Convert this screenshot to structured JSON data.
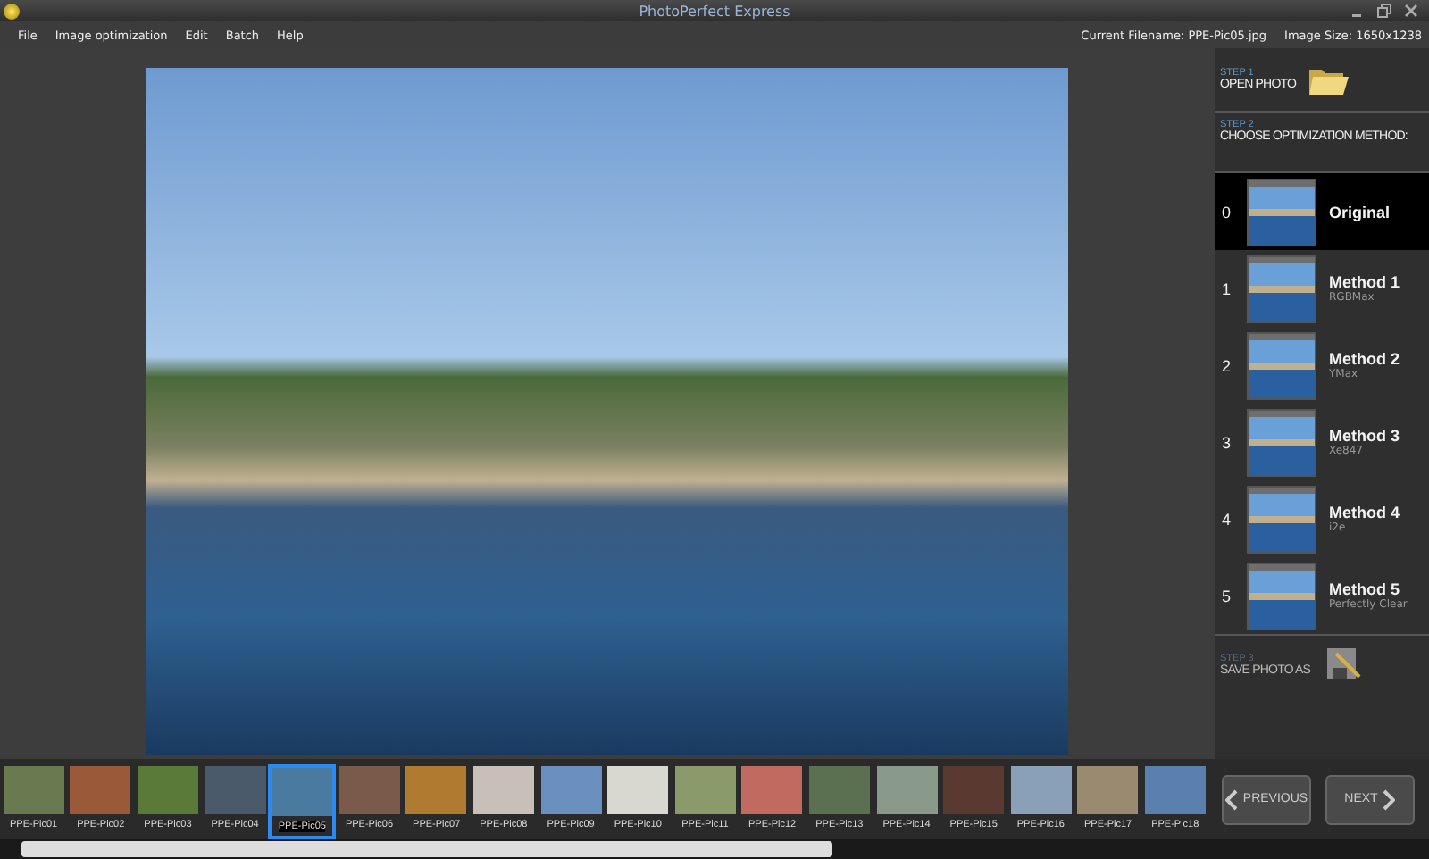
{
  "window": {
    "title": "PhotoPerfect Express"
  },
  "menu": [
    "File",
    "Image optimization",
    "Edit",
    "Batch",
    "Help"
  ],
  "file_info": {
    "filename": "Current Filename: PPE-Pic05.jpg",
    "size": "Image Size: 1650x1238"
  },
  "steps": [
    {
      "step": "STEP 1",
      "title": "OPEN PHOTO"
    },
    {
      "step": "STEP 2",
      "title": "CHOOSE OPTIMIZATION METHOD:"
    },
    {
      "step": "STEP 3",
      "title": "SAVE PHOTO AS"
    }
  ],
  "methods": [
    {
      "index": "0",
      "name": "Original",
      "selected": true
    },
    {
      "index": "1",
      "name": "Method 1",
      "subtitle": "RGBMax",
      "selected": false
    },
    {
      "index": "2",
      "name": "Method 2",
      "subtitle": "YMax",
      "selected": false
    },
    {
      "index": "3",
      "name": "Method 3",
      "subtitle": "Xe847",
      "selected": false
    },
    {
      "index": "4",
      "name": "Method 4",
      "subtitle": "i2e",
      "selected": false
    },
    {
      "index": "5",
      "name": "Method 5",
      "subtitle": "Perfectly Clear",
      "selected": false
    }
  ],
  "filmstrip": [
    {
      "label": "PPE-Pic01",
      "selected": false
    },
    {
      "label": "PPE-Pic02",
      "selected": false
    },
    {
      "label": "PPE-Pic03",
      "selected": false
    },
    {
      "label": "PPE-Pic04",
      "selected": false
    },
    {
      "label": "PPE-Pic05",
      "selected": true
    },
    {
      "label": "PPE-Pic06",
      "selected": false
    },
    {
      "label": "PPE-Pic07",
      "selected": false
    },
    {
      "label": "PPE-Pic08",
      "selected": false
    },
    {
      "label": "PPE-Pic09",
      "selected": false
    },
    {
      "label": "PPE-Pic10",
      "selected": false
    },
    {
      "label": "PPE-Pic11",
      "selected": false
    },
    {
      "label": "PPE-Pic12",
      "selected": false
    },
    {
      "label": "PPE-Pic13",
      "selected": false
    },
    {
      "label": "PPE-Pic14",
      "selected": false
    },
    {
      "label": "PPE-Pic15",
      "selected": false
    },
    {
      "label": "PPE-Pic16",
      "selected": false
    },
    {
      "label": "PPE-Pic17",
      "selected": false
    },
    {
      "label": "PPE-Pic18",
      "selected": false
    }
  ],
  "nav_buttons": [
    "PREVIOUS",
    "NEXT"
  ]
}
